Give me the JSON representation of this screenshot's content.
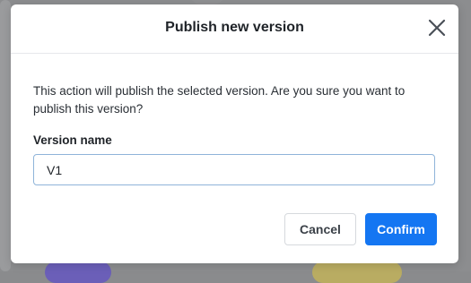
{
  "dialog": {
    "title": "Publish new version",
    "message": "This action will publish the selected version. Are you sure you want to publish this version?",
    "field_label": "Version name",
    "input_value": "V1",
    "input_placeholder": "",
    "cancel_label": "Cancel",
    "confirm_label": "Confirm",
    "close_icon": "close-icon"
  },
  "colors": {
    "primary": "#1476f2",
    "overlay": "#8c8d8f"
  }
}
